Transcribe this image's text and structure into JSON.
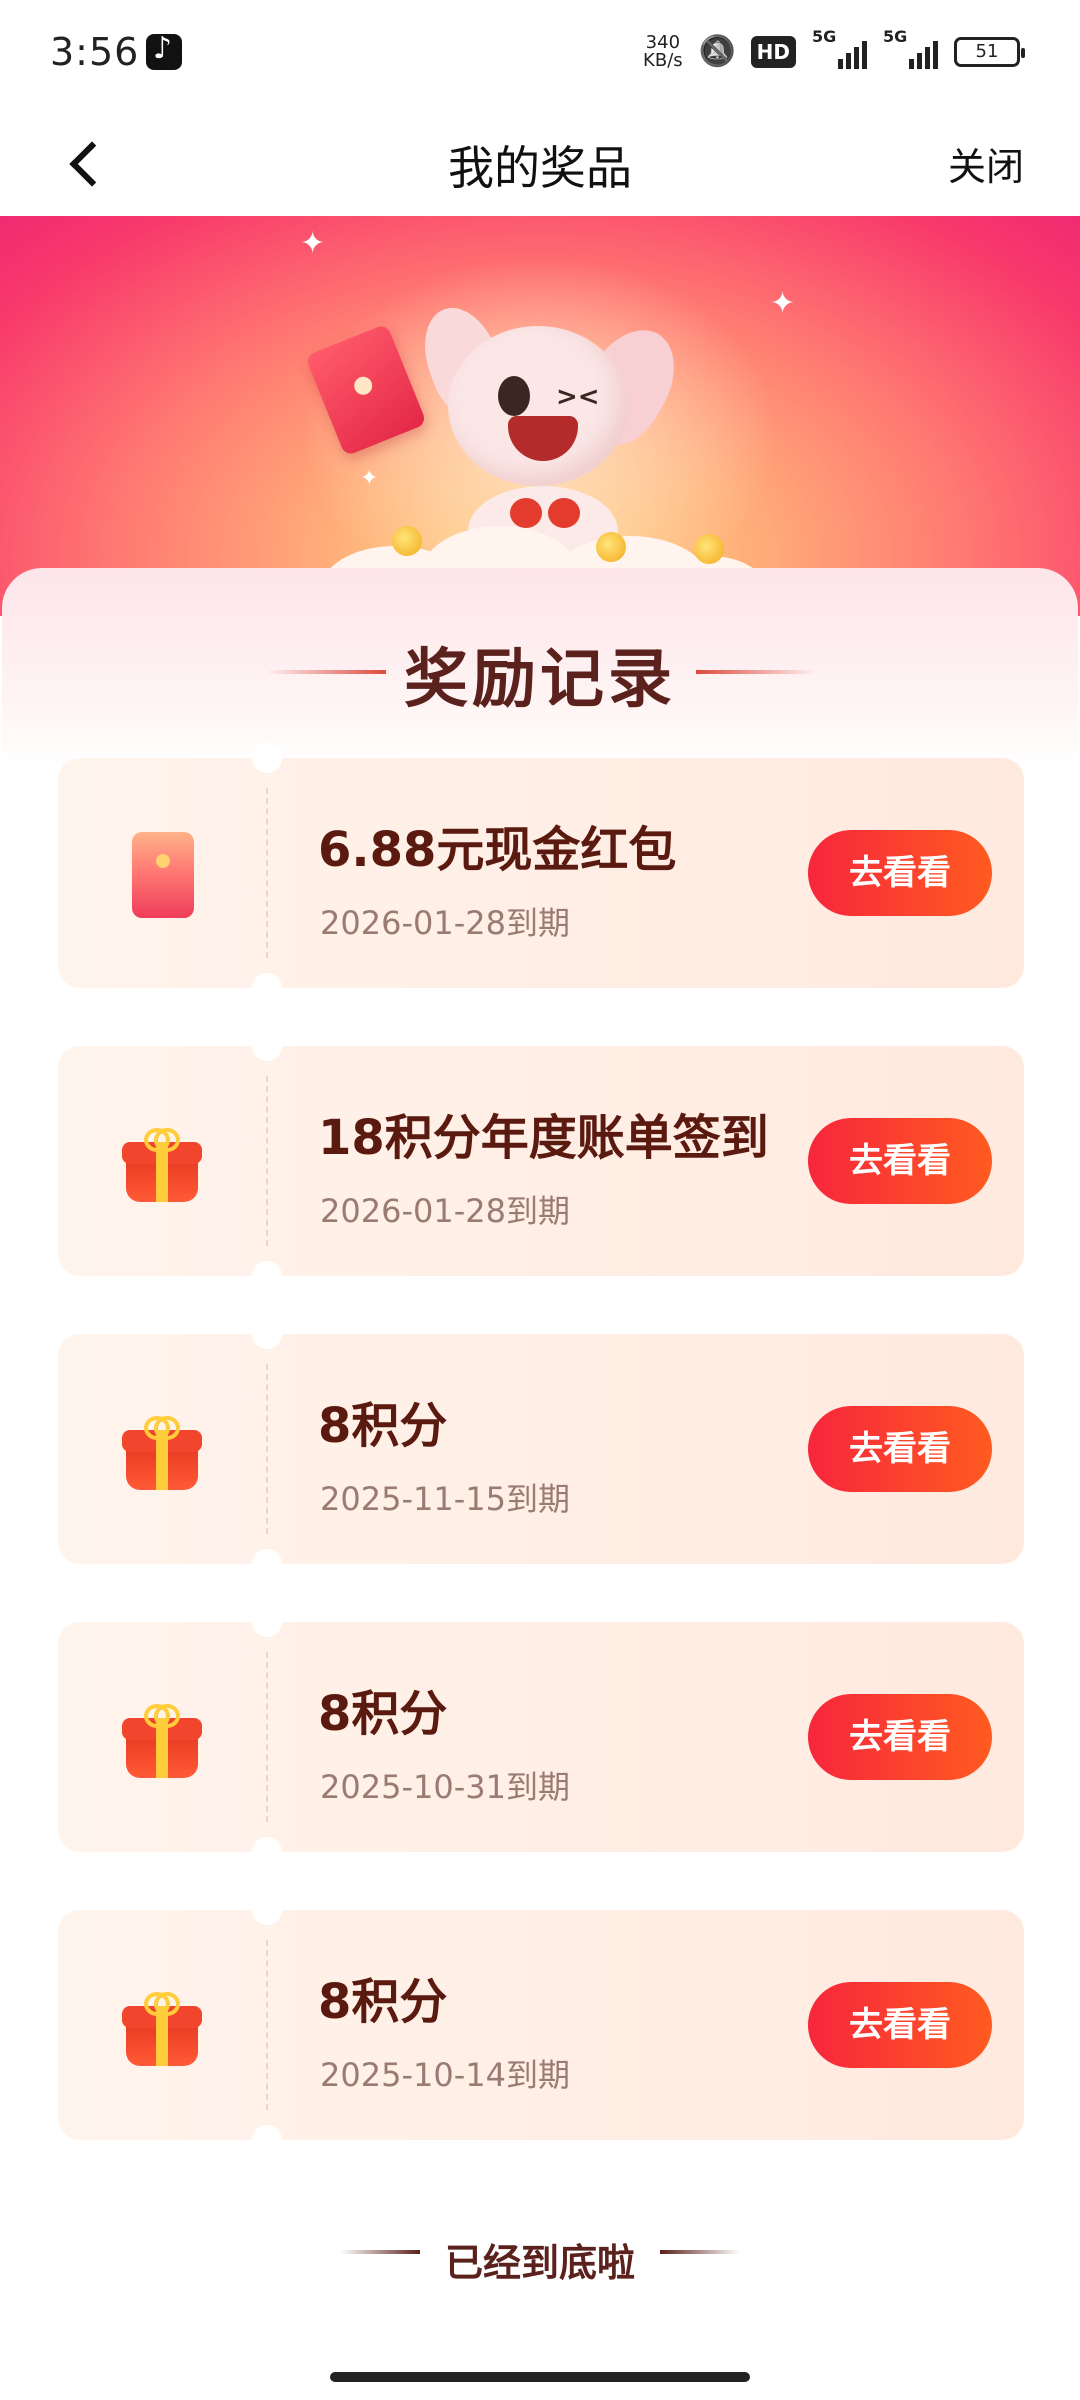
{
  "status_bar": {
    "time": "3:56",
    "net_speed_value": "340",
    "net_speed_unit": "KB/s",
    "hd_label": "HD",
    "signal1_label": "5G",
    "signal2_label": "5G",
    "battery": "51"
  },
  "nav": {
    "title": "我的奖品",
    "close_label": "关闭"
  },
  "section_title": "奖励记录",
  "rewards": [
    {
      "icon": "red-packet-icon",
      "title": "6.88元现金红包",
      "expiry": "2026-01-28到期",
      "button": "去看看"
    },
    {
      "icon": "gift-box-icon",
      "title": "18积分年度账单签到",
      "expiry": "2026-01-28到期",
      "button": "去看看"
    },
    {
      "icon": "gift-box-icon",
      "title": "8积分",
      "expiry": "2025-11-15到期",
      "button": "去看看"
    },
    {
      "icon": "gift-box-icon",
      "title": "8积分",
      "expiry": "2025-10-31到期",
      "button": "去看看"
    },
    {
      "icon": "gift-box-icon",
      "title": "8积分",
      "expiry": "2025-10-14到期",
      "button": "去看看"
    }
  ],
  "end_note": "已经到底啦",
  "colors": {
    "accent_start": "#f7263d",
    "accent_end": "#ff5b1f",
    "title_text": "#5b1a0f",
    "banner_pink": "#f12a72"
  }
}
